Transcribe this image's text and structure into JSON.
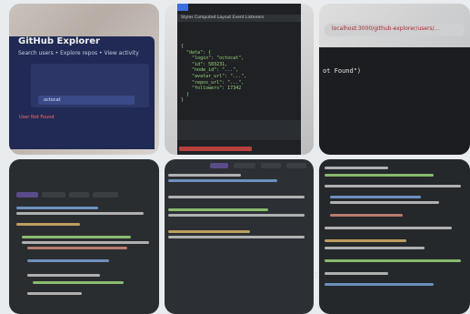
{
  "photo1": {
    "app_title": "GitHub Explorer",
    "subtitle": "Search users • Explore repos • View activity",
    "input_text": "octocat",
    "error_text": "User Not Found"
  },
  "photo2": {
    "devtools_tabs": "Styles  Computed  Layout  Event Listeners",
    "code": "{\n  \"data\": {\n    \"login\": \"octocat\",\n    \"id\": 583231,\n    \"node_id\": \"...\",\n    \"avatar_url\": \"...\",\n    \"repos_url\": \"...\",\n    \"followers\": 17342\n  }\n}"
  },
  "photo3": {
    "url_text": "localhost:3000/github-explorer/users/...",
    "message": "ot Found\")"
  }
}
